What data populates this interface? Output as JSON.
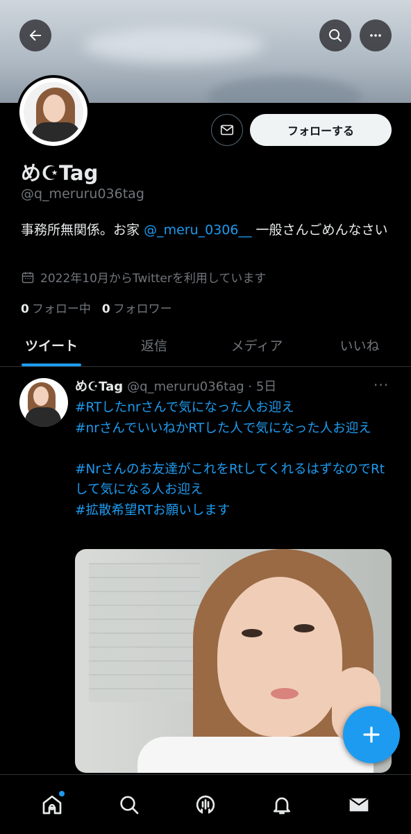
{
  "header": {
    "back_icon": "arrow-left-icon",
    "search_icon": "search-icon",
    "more_icon": "more-horizontal-icon"
  },
  "profile": {
    "name": "め☪︎Tag",
    "handle": "@q_meruru036tag",
    "follow_label": "フォローする",
    "message_icon": "mail-icon",
    "bio_prefix": "事務所無関係。お家",
    "bio_link": "@_meru_0306__",
    "bio_suffix": " 一般さんごめんなさい",
    "joined": "2022年10月からTwitterを利用しています",
    "following_count": "0",
    "following_label": "フォロー中",
    "followers_count": "0",
    "followers_label": "フォロワー"
  },
  "tabs": [
    {
      "label": "ツイート",
      "active": true
    },
    {
      "label": "返信",
      "active": false
    },
    {
      "label": "メディア",
      "active": false
    },
    {
      "label": "いいね",
      "active": false
    }
  ],
  "tweet": {
    "name": "め☪︎Tag",
    "meta": "@q_meruru036tag · 5日",
    "more": "···",
    "lines": [
      "#RTしたnrさんで気になった人お迎え",
      "#nrさんでいいねかRTした人で気になった人お迎え",
      "",
      "#Nrさんのお友達がこれをRtしてくれるはずなのでRtして気になる人お迎え",
      "#拡散希望RTお願いします"
    ]
  },
  "fab": {
    "icon": "compose-plus-icon"
  },
  "bottom_nav": [
    {
      "icon": "home-icon",
      "badge": true
    },
    {
      "icon": "search-icon",
      "badge": false
    },
    {
      "icon": "spaces-icon",
      "badge": false
    },
    {
      "icon": "notifications-icon",
      "badge": false
    },
    {
      "icon": "messages-icon",
      "badge": false
    }
  ],
  "colors": {
    "accent": "#1d9bf0",
    "background": "#000000",
    "text": "#e7e9ea",
    "muted": "#71767b"
  }
}
